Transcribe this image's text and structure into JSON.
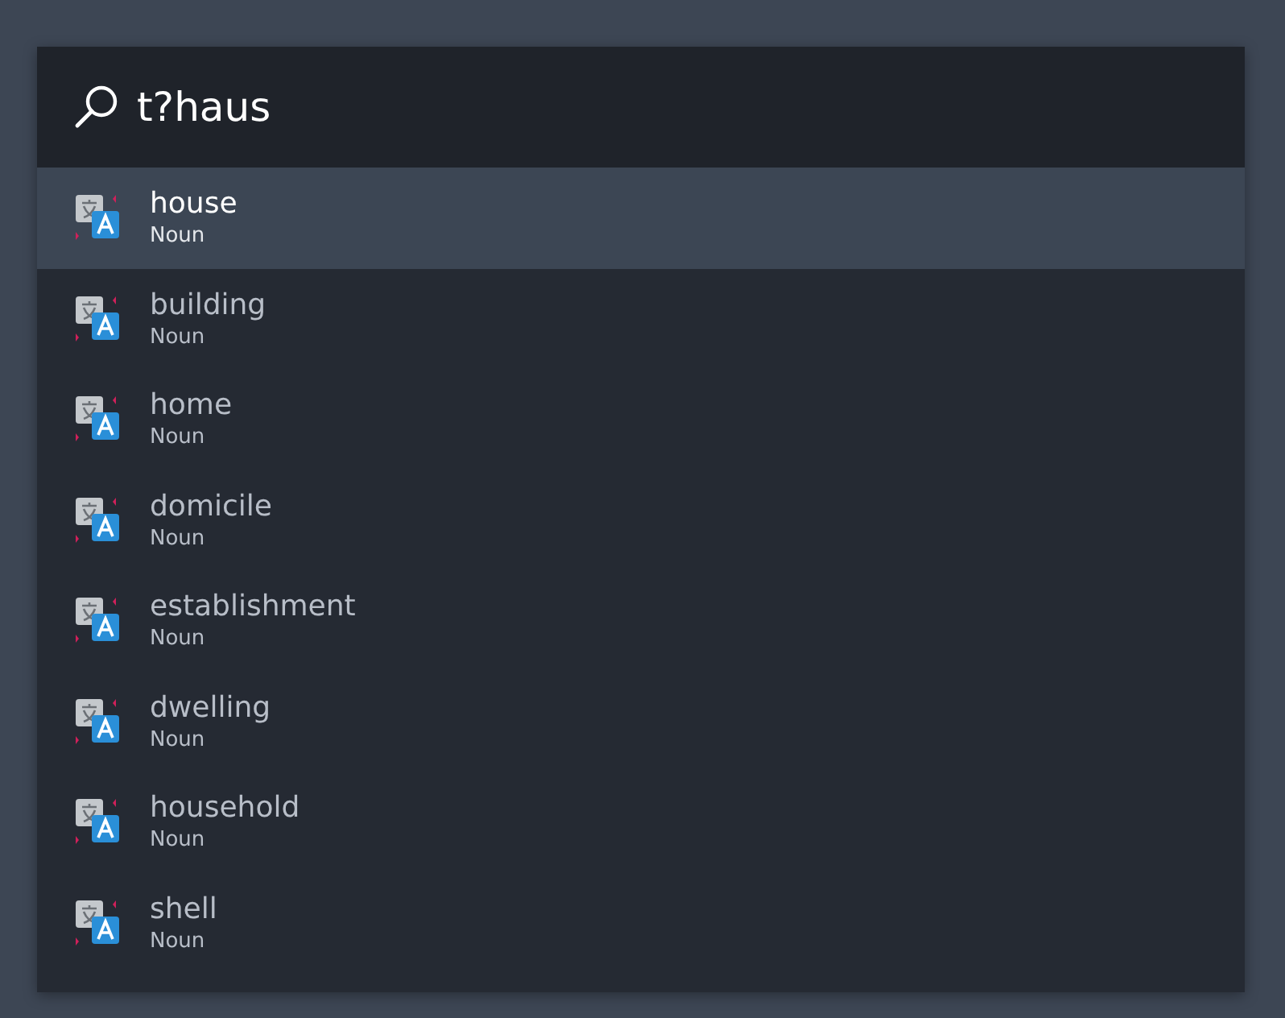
{
  "search": {
    "value": "t?haus"
  },
  "results": [
    {
      "word": "house",
      "type": "Noun",
      "selected": true
    },
    {
      "word": "building",
      "type": "Noun",
      "selected": false
    },
    {
      "word": "home",
      "type": "Noun",
      "selected": false
    },
    {
      "word": "domicile",
      "type": "Noun",
      "selected": false
    },
    {
      "word": "establishment",
      "type": "Noun",
      "selected": false
    },
    {
      "word": "dwelling",
      "type": "Noun",
      "selected": false
    },
    {
      "word": "household",
      "type": "Noun",
      "selected": false
    },
    {
      "word": "shell",
      "type": "Noun",
      "selected": false
    }
  ]
}
